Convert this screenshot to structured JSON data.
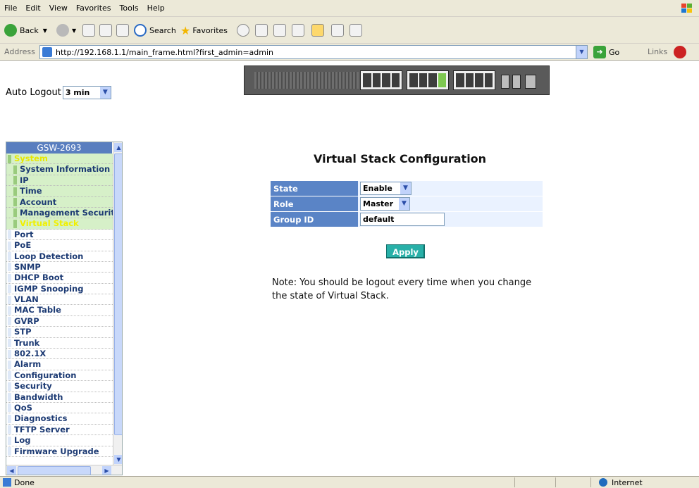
{
  "browser": {
    "menu": [
      "File",
      "Edit",
      "View",
      "Favorites",
      "Tools",
      "Help"
    ],
    "toolbar": {
      "back": "Back",
      "search": "Search",
      "favorites": "Favorites"
    },
    "address_label": "Address",
    "url": "http://192.168.1.1/main_frame.html?first_admin=admin",
    "go": "Go",
    "links": "Links",
    "status": "Done",
    "zone": "Internet"
  },
  "auto_logout": {
    "label": "Auto Logout",
    "value": "3 min"
  },
  "sidebar": {
    "title": "GSW-2693",
    "items": [
      {
        "label": "System",
        "type": "system"
      },
      {
        "label": "System Information",
        "type": "sub"
      },
      {
        "label": "IP",
        "type": "sub"
      },
      {
        "label": "Time",
        "type": "sub"
      },
      {
        "label": "Account",
        "type": "sub"
      },
      {
        "label": "Management Securit",
        "type": "sub"
      },
      {
        "label": "Virtual Stack",
        "type": "active"
      },
      {
        "label": "Port",
        "type": "top"
      },
      {
        "label": "PoE",
        "type": "top"
      },
      {
        "label": "Loop Detection",
        "type": "top"
      },
      {
        "label": "SNMP",
        "type": "top"
      },
      {
        "label": "DHCP Boot",
        "type": "top"
      },
      {
        "label": "IGMP Snooping",
        "type": "top"
      },
      {
        "label": "VLAN",
        "type": "top"
      },
      {
        "label": "MAC Table",
        "type": "top"
      },
      {
        "label": "GVRP",
        "type": "top"
      },
      {
        "label": "STP",
        "type": "top"
      },
      {
        "label": "Trunk",
        "type": "top"
      },
      {
        "label": "802.1X",
        "type": "top"
      },
      {
        "label": "Alarm",
        "type": "top"
      },
      {
        "label": "Configuration",
        "type": "top"
      },
      {
        "label": "Security",
        "type": "top"
      },
      {
        "label": "Bandwidth",
        "type": "top"
      },
      {
        "label": "QoS",
        "type": "top"
      },
      {
        "label": "Diagnostics",
        "type": "top"
      },
      {
        "label": "TFTP Server",
        "type": "top"
      },
      {
        "label": "Log",
        "type": "top"
      },
      {
        "label": "Firmware Upgrade",
        "type": "top"
      }
    ]
  },
  "main": {
    "title": "Virtual Stack Configuration",
    "state": {
      "label": "State",
      "value": "Enable"
    },
    "role": {
      "label": "Role",
      "value": "Master"
    },
    "group_id": {
      "label": "Group ID",
      "value": "default"
    },
    "apply": "Apply",
    "note": "Note: You should be logout every time when you change the state of Virtual Stack."
  },
  "colors": {
    "accent": "#5a84c6",
    "apply": "#28b0a8",
    "sidebar_header": "#597ebf",
    "system_yellow": "#e8e800"
  }
}
